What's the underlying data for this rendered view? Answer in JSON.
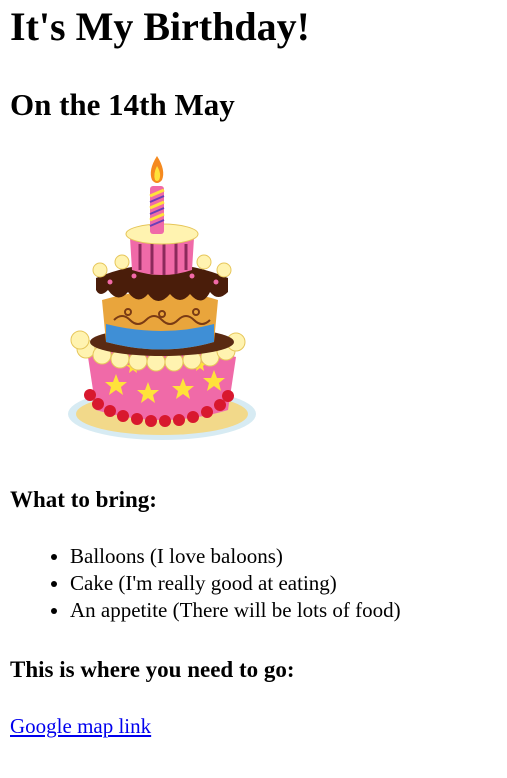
{
  "header": {
    "title": "It's My Birthday!",
    "subtitle": "On the 14th May"
  },
  "image": {
    "icon": "birthday-cake-icon"
  },
  "bring": {
    "heading": "What to bring:",
    "items": [
      "Balloons (I love baloons)",
      "Cake (I'm really good at eating)",
      "An appetite (There will be lots of food)"
    ]
  },
  "directions": {
    "heading": "This is where you need to go:",
    "link_label": "Google map link"
  },
  "colors": {
    "link": "#0000ee",
    "text": "#000000",
    "background": "#ffffff"
  }
}
